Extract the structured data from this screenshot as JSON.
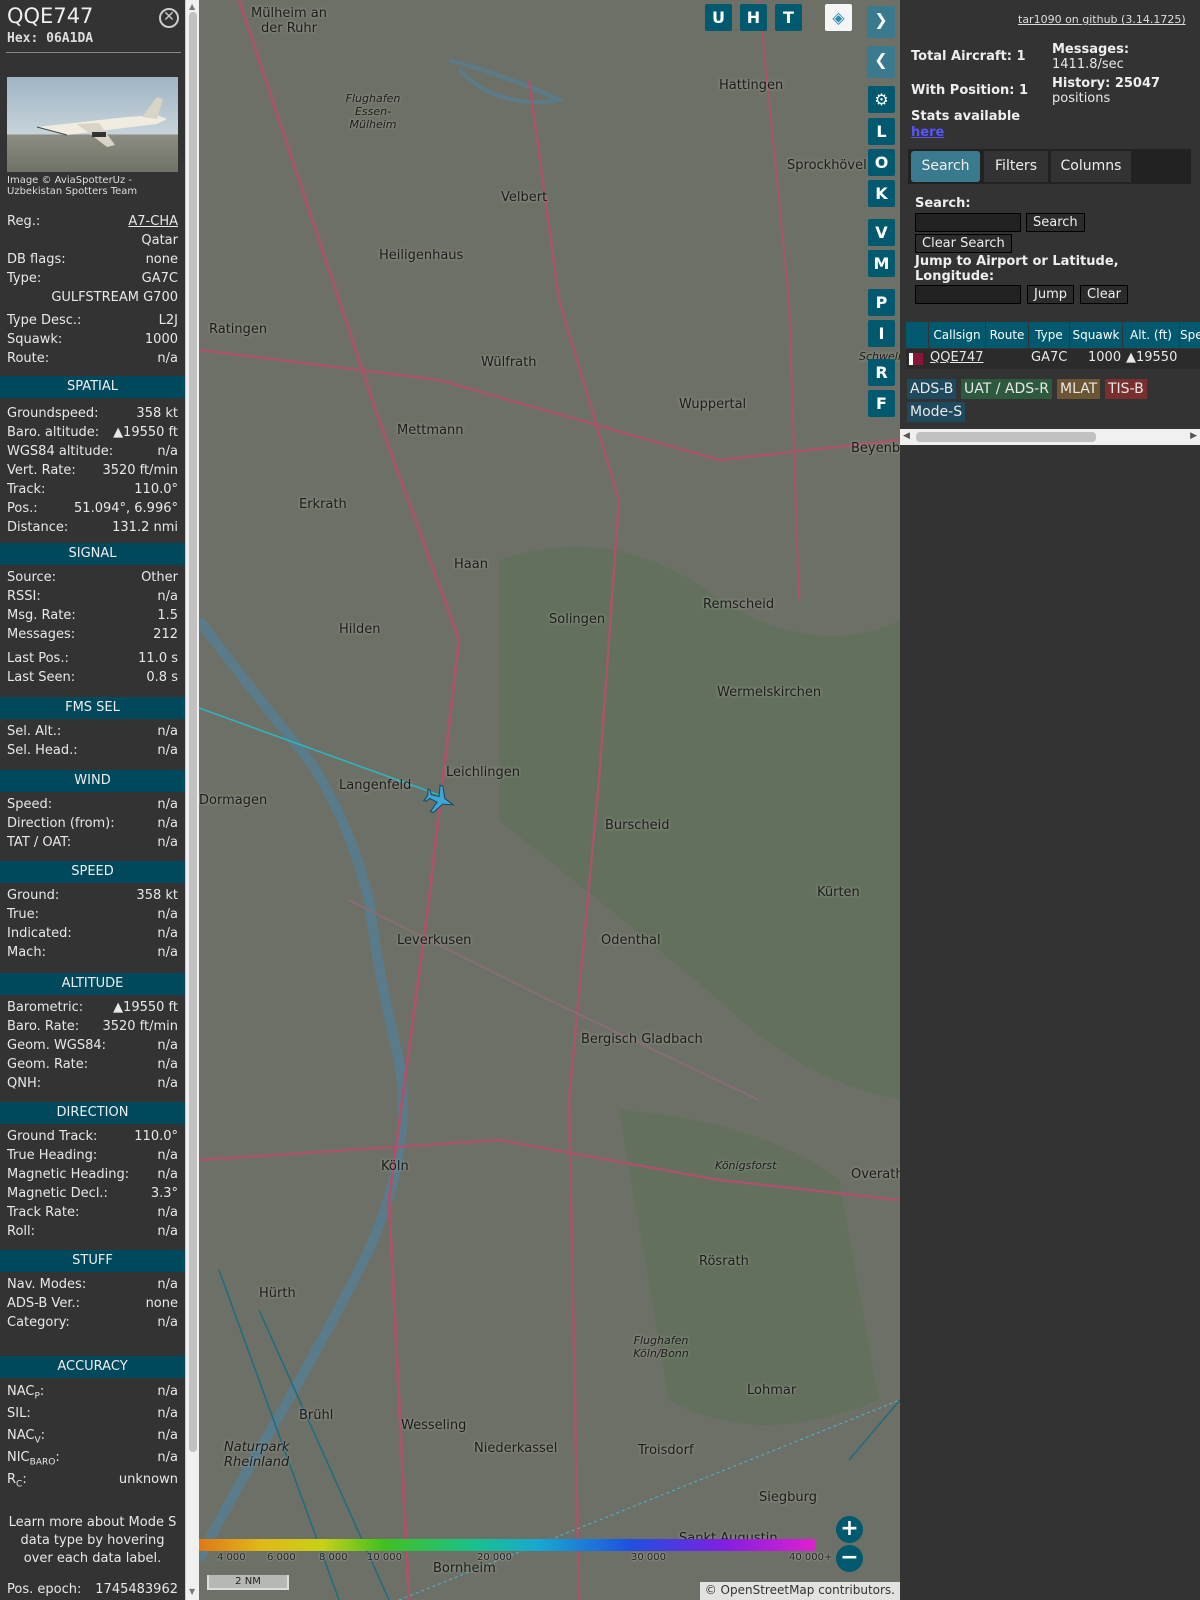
{
  "aircraft": {
    "callsign": "QQE747",
    "hex": "Hex: 06A1DA",
    "photo_credit": "Image © AviaSpotterUz - Uzbekistan Spotters Team",
    "reg_label": "Reg.:",
    "reg": "A7-CHA",
    "country": "Qatar",
    "dbflags_label": "DB flags:",
    "dbflags": "none",
    "type_label": "Type:",
    "type": "GA7C",
    "type_name": "GULFSTREAM G700",
    "typedesc_label": "Type Desc.:",
    "typedesc": "L2J",
    "squawk_label": "Squawk:",
    "squawk": "1000",
    "route_label": "Route:",
    "route": "n/a"
  },
  "sections": {
    "spatial": "SPATIAL",
    "signal": "SIGNAL",
    "fms": "FMS SEL",
    "wind": "WIND",
    "speed": "SPEED",
    "altitude": "ALTITUDE",
    "direction": "DIRECTION",
    "stuff": "STUFF",
    "accuracy": "ACCURACY"
  },
  "spatial": [
    [
      "Groundspeed:",
      "358 kt"
    ],
    [
      "Baro. altitude:",
      "▲19550 ft"
    ],
    [
      "WGS84 altitude:",
      "n/a"
    ],
    [
      "Vert. Rate:",
      "3520 ft/min"
    ],
    [
      "Track:",
      "110.0°"
    ],
    [
      "Pos.:",
      "51.094°, 6.996°"
    ],
    [
      "Distance:",
      "131.2 nmi"
    ]
  ],
  "signal": [
    [
      "Source:",
      "Other"
    ],
    [
      "RSSI:",
      "n/a"
    ],
    [
      "Msg. Rate:",
      "1.5"
    ],
    [
      "Messages:",
      "212"
    ],
    [
      "Last Pos.:",
      "11.0 s"
    ],
    [
      "Last Seen:",
      "0.8 s"
    ]
  ],
  "fms": [
    [
      "Sel. Alt.:",
      "n/a"
    ],
    [
      "Sel. Head.:",
      "n/a"
    ]
  ],
  "wind": [
    [
      "Speed:",
      "n/a"
    ],
    [
      "Direction (from):",
      "n/a"
    ],
    [
      "TAT / OAT:",
      "n/a"
    ]
  ],
  "speed": [
    [
      "Ground:",
      "358 kt"
    ],
    [
      "True:",
      "n/a"
    ],
    [
      "Indicated:",
      "n/a"
    ],
    [
      "Mach:",
      "n/a"
    ]
  ],
  "altitude": [
    [
      "Barometric:",
      "▲19550 ft"
    ],
    [
      "Baro. Rate:",
      "3520 ft/min"
    ],
    [
      "Geom. WGS84:",
      "n/a"
    ],
    [
      "Geom. Rate:",
      "n/a"
    ],
    [
      "QNH:",
      "n/a"
    ]
  ],
  "direction": [
    [
      "Ground Track:",
      "110.0°"
    ],
    [
      "True Heading:",
      "n/a"
    ],
    [
      "Magnetic Heading:",
      "n/a"
    ],
    [
      "Magnetic Decl.:",
      "3.3°"
    ],
    [
      "Track Rate:",
      "n/a"
    ],
    [
      "Roll:",
      "n/a"
    ]
  ],
  "stuff": [
    [
      "Nav. Modes:",
      "n/a"
    ],
    [
      "ADS-B Ver.:",
      "none"
    ],
    [
      "Category:",
      "n/a"
    ]
  ],
  "accuracy": [
    [
      "NAC",
      "P",
      ":",
      "n/a"
    ],
    [
      "SIL:",
      "",
      "",
      "n/a"
    ],
    [
      "NAC",
      "V",
      ":",
      "n/a"
    ],
    [
      "NIC",
      "BARO",
      ":",
      "n/a"
    ],
    [
      "R",
      "C",
      ":",
      "unknown"
    ]
  ],
  "note": "Learn more about Mode S data type by hovering over each data label.",
  "epoch": [
    "Pos. epoch:",
    "1745483962"
  ],
  "mapbtns": {
    "u": "U",
    "h": "H",
    "t": "T",
    "l": "L",
    "o": "O",
    "k": "K",
    "v": "V",
    "m": "M",
    "p": "P",
    "i": "I",
    "r": "R",
    "f": "F"
  },
  "map": {
    "scale": "2 NM",
    "attribution": "© OpenStreetMap contributors.",
    "alt_ticks": [
      "4 000",
      "6 000",
      "8 000",
      "10 000",
      "20 000",
      "30 000",
      "40 000+"
    ],
    "towns": [
      "Mülheim an der Ruhr",
      "Hattingen",
      "Sprockhövel",
      "Velbert",
      "Heiligenhaus",
      "Ratingen",
      "Wülfrath",
      "Wuppertal",
      "Mettmann",
      "Erkrath",
      "Haan",
      "Solingen",
      "Remscheid",
      "Hilden",
      "Leichlingen",
      "Wermelskirchen",
      "Langenfeld",
      "Dormagen",
      "Burscheid",
      "Leverkusen",
      "Odenthal",
      "Kürten",
      "Bergisch Gladbach",
      "Köln",
      "Overath",
      "Rösrath",
      "Hürth",
      "Brühl",
      "Wesseling",
      "Niederkassel",
      "Troisdorf",
      "Lohmar",
      "Siegburg",
      "Sankt Augustin",
      "Bornheim",
      "Beyenburg",
      "Schwelm",
      "Königsforst",
      "Flughafen Essen-Mülheim",
      "Flughafen Köln/Bonn",
      "Naturpark Rheinland"
    ]
  },
  "right": {
    "github": "tar1090 on github (3.14.1725)",
    "total": "Total Aircraft: 1",
    "withpos": "With Position: 1",
    "stats": "Stats available",
    "here": "here",
    "messages_label": "Messages:",
    "messages": "1411.8/sec",
    "history_label": "History: 25047",
    "history": "positions",
    "tabs": [
      "Search",
      "Filters",
      "Columns"
    ],
    "search_label": "Search:",
    "search_btn": "Search",
    "clear_search": "Clear Search",
    "jump_label": "Jump to Airport or Latitude, Longitude:",
    "jump_btn": "Jump",
    "clear_btn": "Clear",
    "cols": [
      "Callsign",
      "Route",
      "Type",
      "Squawk",
      "Alt. (ft)",
      "Spe"
    ],
    "row": {
      "callsign": "QQE747",
      "route": "",
      "type": "GA7C",
      "squawk": "1000",
      "alt": "▲19550"
    },
    "badges": [
      "ADS-B",
      "UAT / ADS-R",
      "MLAT",
      "TIS-B",
      "Mode-S"
    ]
  },
  "colors": {
    "header": "#00485c",
    "button": "#00596e",
    "adsb": "#1f4a5e",
    "uat": "#2d5a3e",
    "mlat": "#6b5533",
    "tisb": "#7a2f2f"
  }
}
